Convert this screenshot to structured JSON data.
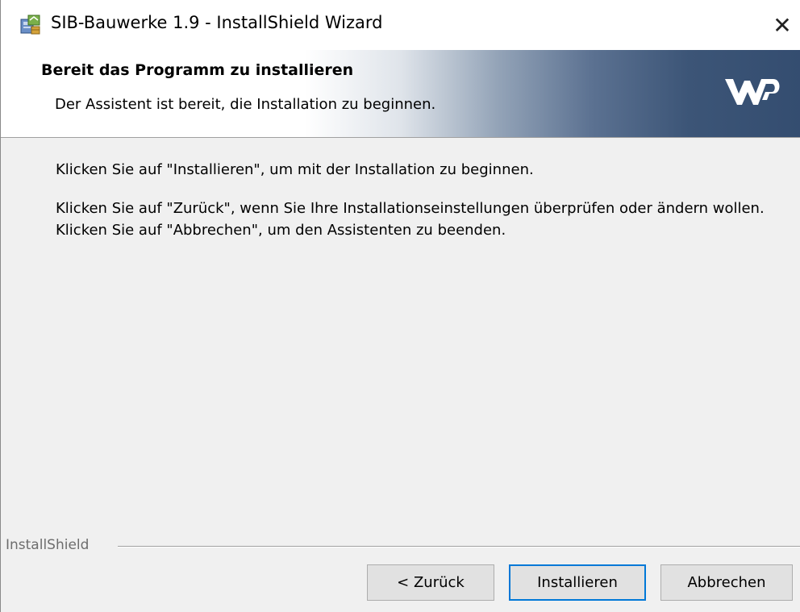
{
  "window": {
    "title": "SIB-Bauwerke 1.9 - InstallShield Wizard",
    "close_glyph": "✕",
    "icon": "installer-package-icon"
  },
  "banner": {
    "title": "Bereit das Programm zu installieren",
    "subtitle": "Der Assistent ist bereit, die Installation zu beginnen.",
    "logo": "wmp-logo",
    "gradient_colors": [
      "#ffffff",
      "#94a4b8",
      "#344d70"
    ]
  },
  "body": {
    "paragraph1": "Klicken Sie auf \"Installieren\", um mit der Installation zu beginnen.",
    "paragraph2": "Klicken Sie auf \"Zurück\", wenn Sie Ihre Installationseinstellungen überprüfen oder ändern wollen. Klicken Sie auf \"Abbrechen\", um den Assistenten zu beenden."
  },
  "footer": {
    "brand": "InstallShield",
    "buttons": {
      "back": "< Zurück",
      "install": "Installieren",
      "cancel": "Abbrechen"
    },
    "focus_color": "#0078d7"
  }
}
